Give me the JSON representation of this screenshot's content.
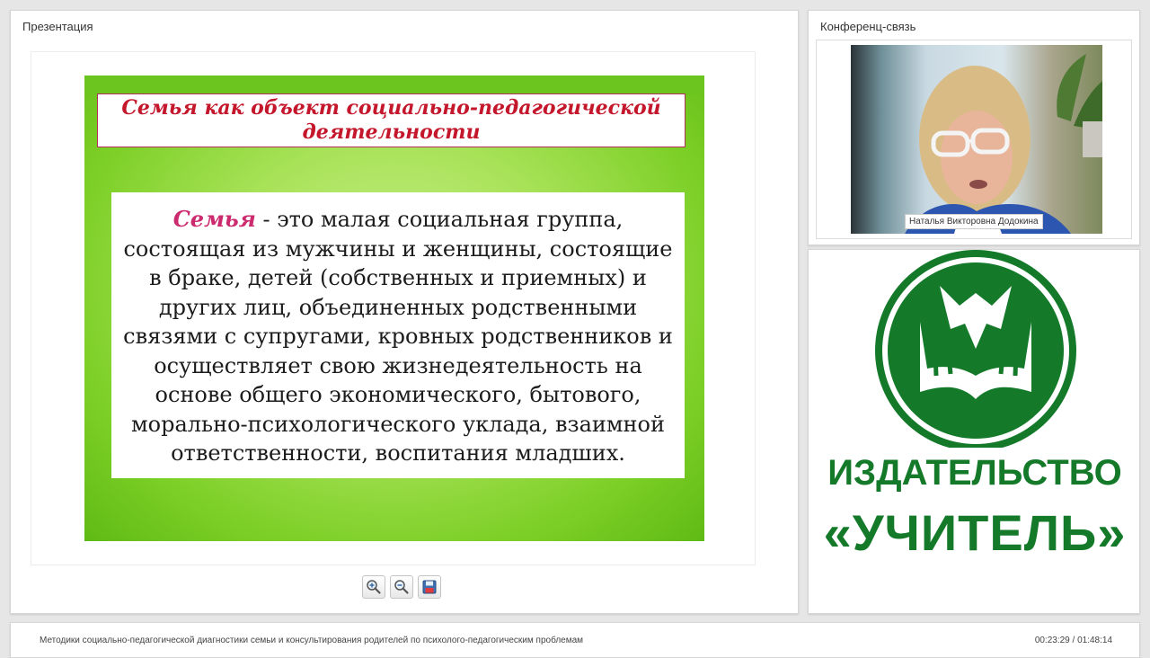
{
  "presentation_panel": {
    "title": "Презентация"
  },
  "slide": {
    "title": "Семья как объект социально-педагогической деятельности",
    "term": "Семья",
    "definition": " - это малая социальная группа, состоящая из мужчины и женщины, состоящие в браке, детей (собственных и приемных) и других лиц, объединенных родственными связями с супругами, кровных родственников и осуществляет свою жизнедеятельность на основе общего экономического, бытового, морально-психологического уклада, взаимной ответственности, воспитания младших."
  },
  "toolbar": {
    "zoom_in_icon": "zoom-in-icon",
    "zoom_out_icon": "zoom-out-icon",
    "save_icon": "save-icon"
  },
  "conference_panel": {
    "title": "Конференц-связь",
    "participant_name": "Наталья Викторовна Додокина"
  },
  "logo": {
    "line1": "ИЗДАТЕЛЬСТВО",
    "line2": "«УЧИТЕЛЬ»",
    "color": "#147a2a"
  },
  "footer": {
    "course_title": "Методики социально-педагогической диагностики семьи и консультирования родителей по психолого-педагогическим проблемам",
    "time": "00:23:29 / 01:48:14"
  }
}
